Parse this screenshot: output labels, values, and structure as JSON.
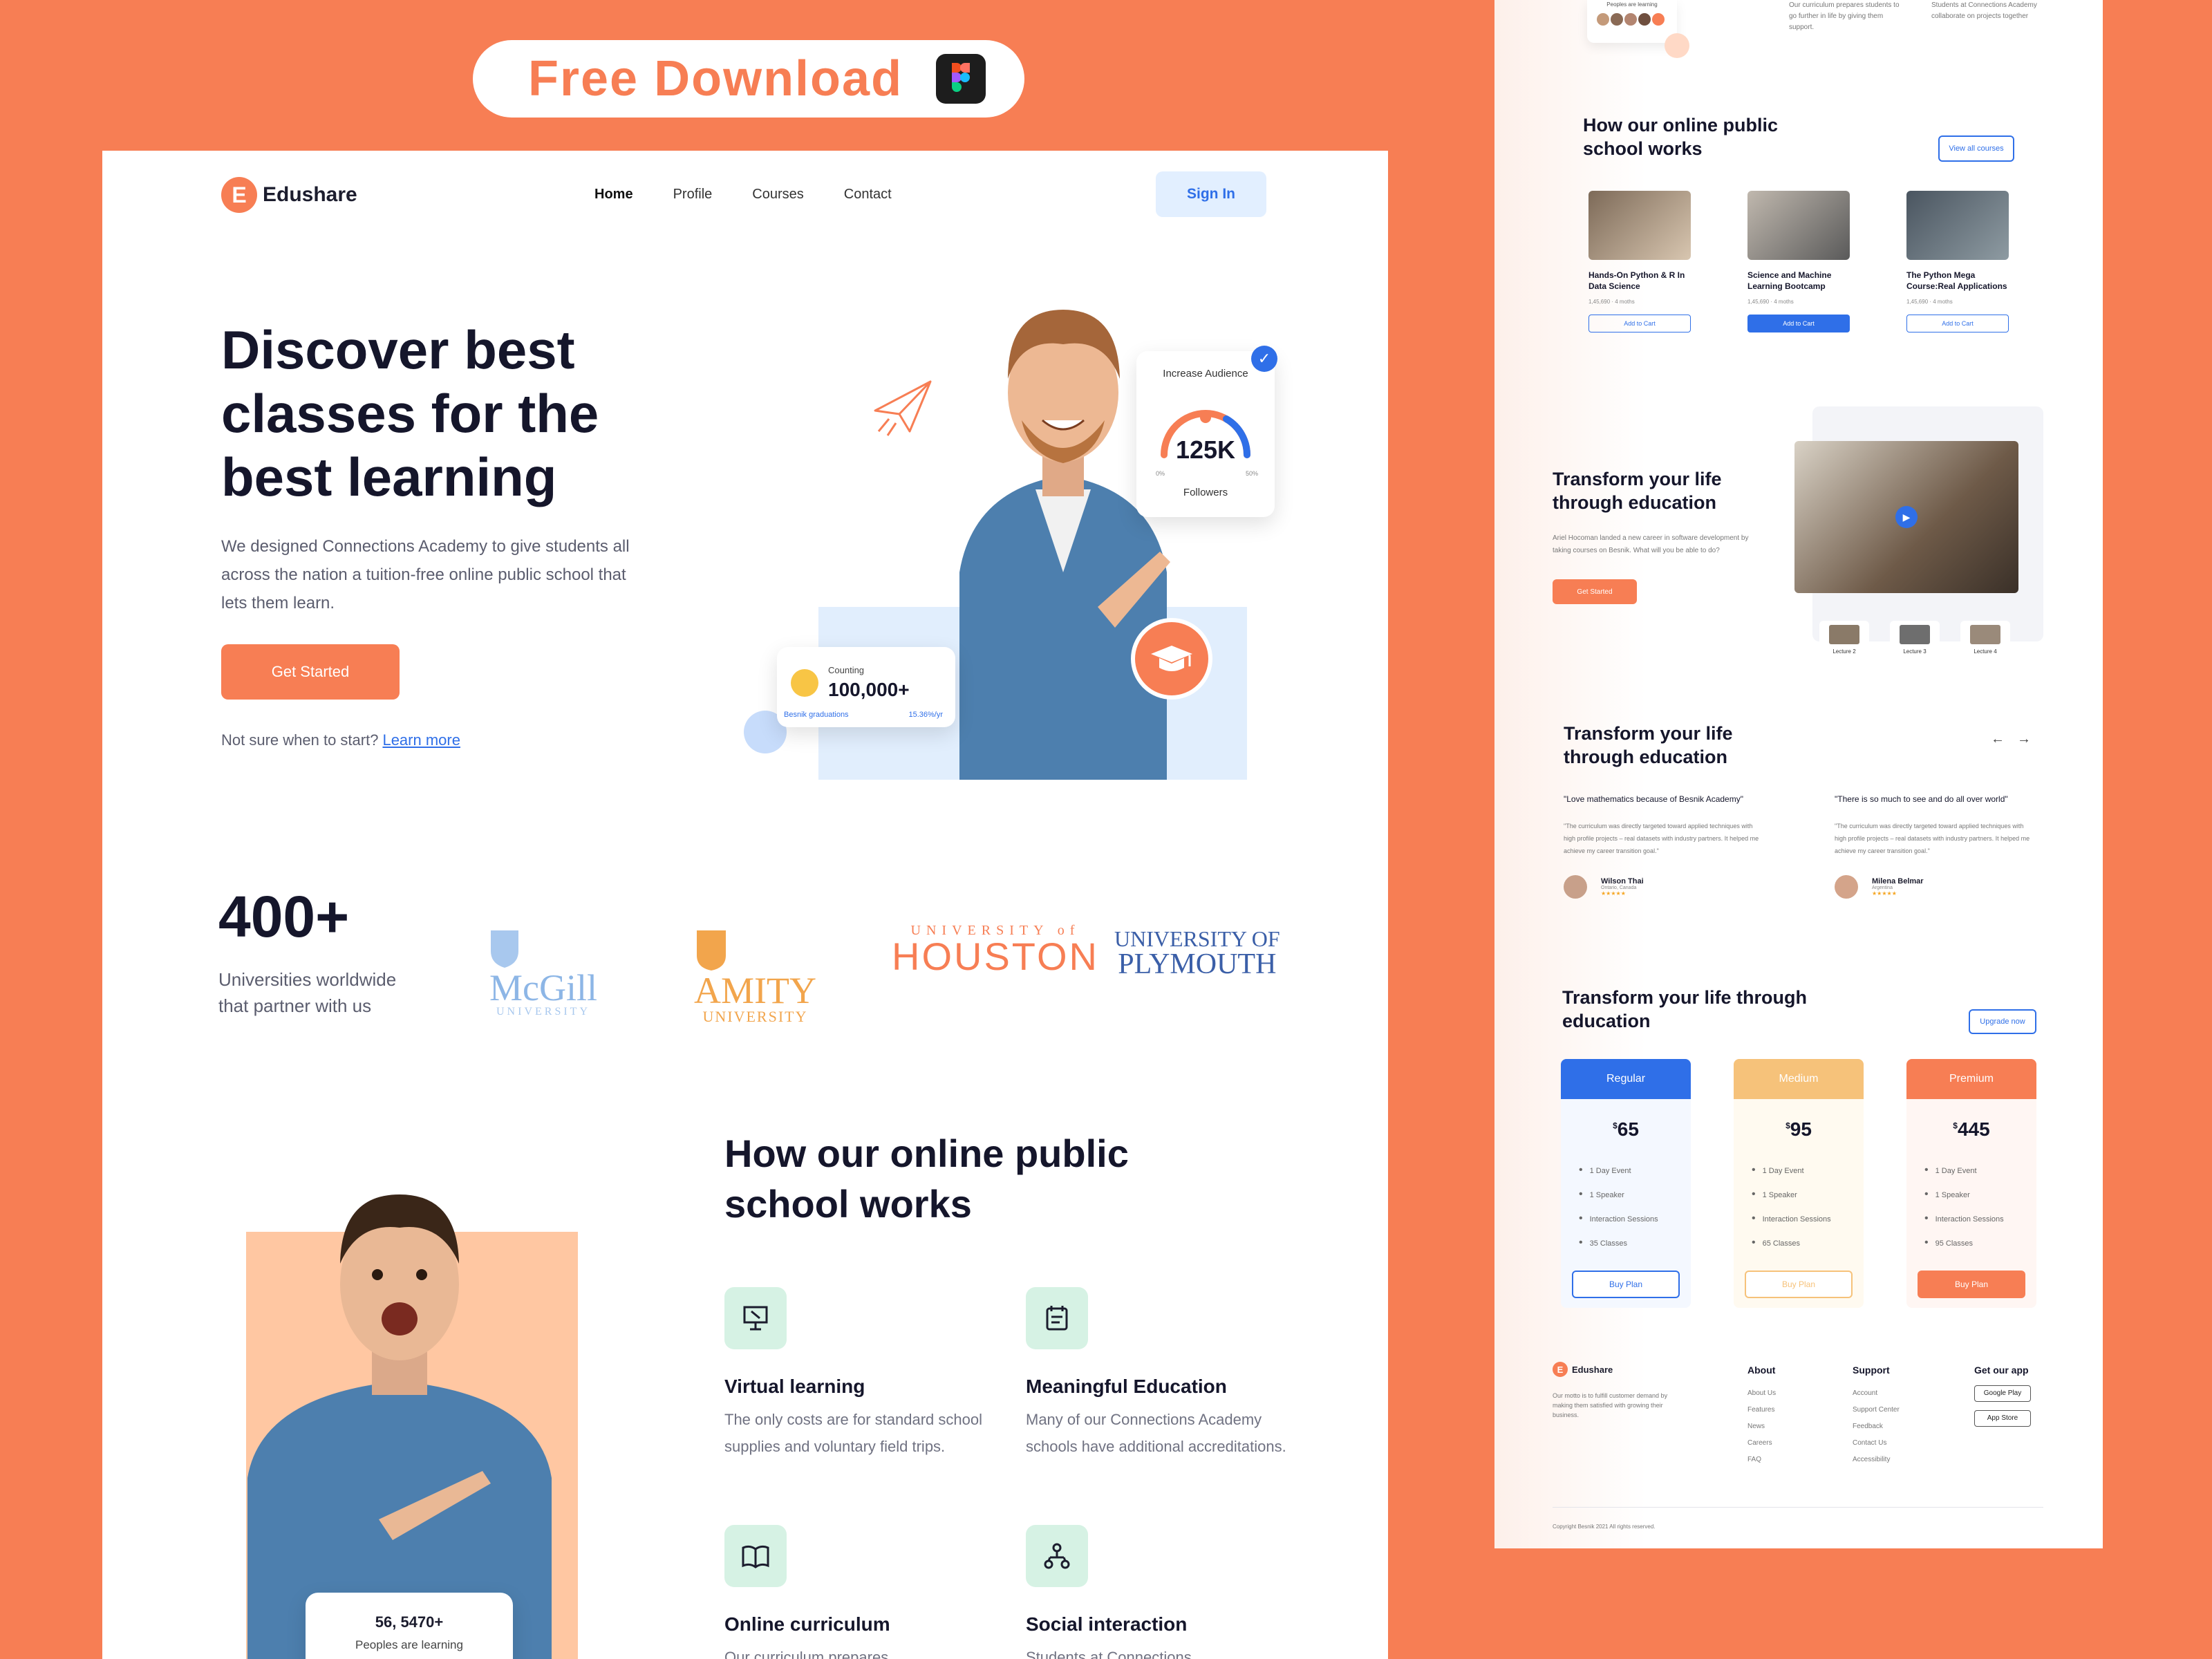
{
  "banner": {
    "label": "Free Download"
  },
  "nav": {
    "brand": "Edushare",
    "brand_initial": "E",
    "links": [
      "Home",
      "Profile",
      "Courses",
      "Contact"
    ],
    "signin": "Sign In"
  },
  "hero": {
    "title": "Discover best classes for the best  learning",
    "description": "We designed Connections Academy to give students all across the nation a tuition-free online public school that lets them learn.",
    "cta": "Get Started",
    "learn_prefix": "Not sure when to start?",
    "learn_link": "Learn more",
    "audience_title": "Increase Audience",
    "audience_value": "125K",
    "audience_footer": "Followers",
    "gauge_min": "0%",
    "gauge_max": "50%",
    "counting_label": "Counting",
    "counting_value": "100,000+",
    "counting_footer": "Besnik graduations",
    "counting_rate": "15.36%/yr"
  },
  "stats": {
    "number": "400+",
    "text": "Universities worldwide that partner with us",
    "universities": [
      {
        "name": "McGill",
        "sub": "UNIVERSITY",
        "color": "#8db6e6"
      },
      {
        "name": "AMITY",
        "sub": "UNIVERSITY",
        "color": "#f2a54c"
      },
      {
        "name": "HOUSTON",
        "sub": "UNIVERSITY of",
        "color": "#F77E54"
      },
      {
        "name": "UNIVERSITY OF",
        "sub": "PLYMOUTH",
        "color": "#3b5fa8"
      }
    ]
  },
  "how": {
    "title": "How our online public school works",
    "bubble_value": "56, 5470+",
    "bubble_label": "Peoples are learning",
    "features": [
      {
        "icon": "presentation-icon",
        "title": "Virtual learning",
        "desc": "The only costs are for standard school supplies and voluntary field trips."
      },
      {
        "icon": "notepad-icon",
        "title": "Meaningful Education",
        "desc": "Many of our Connections Academy schools have additional accreditations."
      },
      {
        "icon": "book-icon",
        "title": "Online curriculum",
        "desc": "Our curriculum prepares"
      },
      {
        "icon": "network-icon",
        "title": "Social interaction",
        "desc": "Students at Connections"
      }
    ]
  },
  "side": {
    "top_left_label": "Peoples are learning",
    "top_mid": "Our curriculum prepares students to go further in life by giving them support.",
    "top_right": "Students at Connections Academy collaborate on projects together",
    "courses_title": "How our online public school works",
    "courses_btn": "View all courses",
    "courses": [
      {
        "title": "Hands-On Python & R In Data Science",
        "meta": "1,45,690 · 4 moths",
        "btn": "Add to Cart",
        "filled": false
      },
      {
        "title": "Science and Machine Learning Bootcamp",
        "meta": "1,45,690 · 4 moths",
        "btn": "Add to Cart",
        "filled": true
      },
      {
        "title": "The Python Mega Course:Real Applications",
        "meta": "1,45,690 · 4 moths",
        "btn": "Add to Cart",
        "filled": false
      }
    ],
    "video_title": "Transform your life through education",
    "video_desc": "Ariel Hocoman landed a new career in software development by taking courses on Besnik. What will you be able to do?",
    "video_cta": "Get Started",
    "lectures": [
      "Lecture 2",
      "Lecture 3",
      "Lecture 4"
    ],
    "test_title": "Transform your life through education",
    "testimonials": [
      {
        "quote": "\"Love mathematics because of Besnik Academy\"",
        "body": "\"The curriculum was directly targeted toward applied techniques with high profile projects – real datasets with industry partners. It helped me achieve my career transition goal.\"",
        "name": "Wilson Thai",
        "place": "Ontario, Canada"
      },
      {
        "quote": "\"There is so much to see and do all over world\"",
        "body": "\"The curriculum was directly targeted toward applied techniques with high profile projects – real datasets with industry partners. It helped me achieve my career transition goal.\"",
        "name": "Milena Belmar",
        "place": "Argentina"
      }
    ],
    "pricing_title": "Transform your life through education",
    "pricing_btn": "Upgrade now",
    "plans": [
      {
        "name": "Regular",
        "price": "65",
        "items": [
          "1 Day Event",
          "1 Speaker",
          "Interaction Sessions",
          "35 Classes"
        ],
        "btn": "Buy Plan",
        "color": "#2f6fe8",
        "bg": "#f4f8ff"
      },
      {
        "name": "Medium",
        "price": "95",
        "items": [
          "1 Day Event",
          "1 Speaker",
          "Interaction Sessions",
          "65 Classes"
        ],
        "btn": "Buy Plan",
        "color": "#f6c27a",
        "bg": "#fffaf0"
      },
      {
        "name": "Premium",
        "price": "445",
        "items": [
          "1 Day Event",
          "1 Speaker",
          "Interaction Sessions",
          "95 Classes"
        ],
        "btn": "Buy Plan",
        "color": "#F77E54",
        "bg": "#fff6f3"
      }
    ],
    "footer_brand": "Edushare",
    "footer_motto": "Our motto is to fulfill customer demand by making them satisfied with growing their business.",
    "footer_about_title": "About",
    "footer_about": [
      "About Us",
      "Features",
      "News",
      "Careers",
      "FAQ"
    ],
    "footer_support_title": "Support",
    "footer_support": [
      "Account",
      "Support Center",
      "Feedback",
      "Contact Us",
      "Accessibility"
    ],
    "footer_app_title": "Get our app",
    "footer_apps": [
      "Google Play",
      "App Store"
    ],
    "copyright": "Copyright Besnik 2021 All rights reserved."
  }
}
